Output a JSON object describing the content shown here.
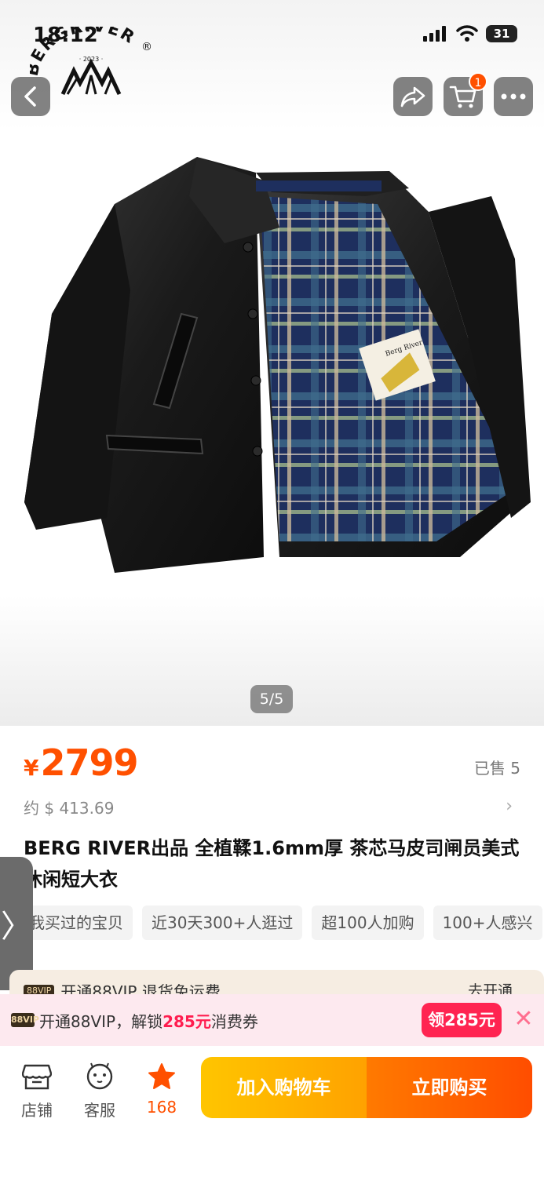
{
  "status_bar": {
    "time": "18:12",
    "battery": "31"
  },
  "brand": {
    "name": "BERGRIVER",
    "year": "· 2023 ·",
    "registered": "®"
  },
  "nav": {
    "cart_count": "1"
  },
  "gallery": {
    "indicator": "5/5",
    "patch_text": "Berg River"
  },
  "product": {
    "price_symbol": "¥",
    "price": "2799",
    "sold": "已售 5",
    "usd_approx": "约 $ 413.69",
    "title": "BERG RIVER出品 全植鞣1.6mm厚 茶芯马皮司闸员美式休闲短大衣",
    "tags": [
      "我买过的宝贝",
      "近30天300+人逛过",
      "超100人加购",
      "100+人感兴"
    ]
  },
  "vip_strip": {
    "badge": "88VIP",
    "text": "开通88VIP  退货免运费",
    "action": "去开通"
  },
  "coupon": {
    "badge": "88VIP",
    "text_prefix": "开通88VIP，解锁",
    "amount": "285元",
    "text_suffix": "消费券",
    "button": "领285元",
    "close": "✕"
  },
  "bottom_bar": {
    "store": "店铺",
    "service": "客服",
    "favorites": "168",
    "add_to_cart": "加入购物车",
    "buy_now": "立即购买"
  },
  "colors": {
    "accent": "#ff5000",
    "coupon_red": "#ff2451",
    "cart_yellow": "#ffb000"
  }
}
